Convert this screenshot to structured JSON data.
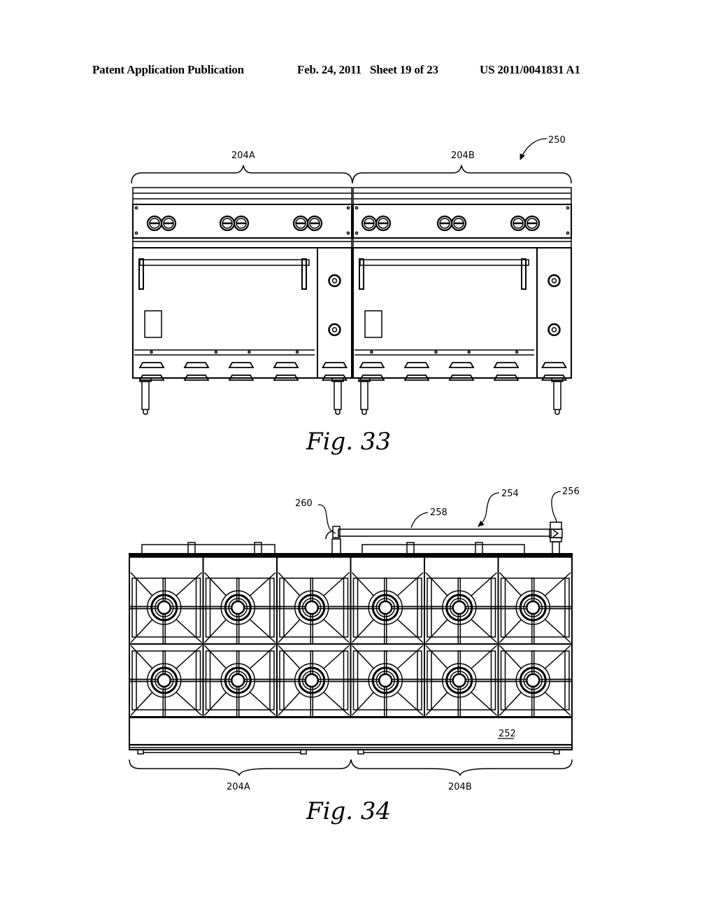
{
  "header": {
    "publication_type": "Patent Application Publication",
    "date": "Feb. 24, 2011",
    "sheet": "Sheet 19 of 23",
    "publication_number": "US 2011/0041831 A1"
  },
  "figures": [
    {
      "id": "fig33",
      "caption": "Fig. 33",
      "view": "front elevation",
      "labels": {
        "assembly": "250",
        "left_unit": "204A",
        "right_unit": "204B"
      },
      "units": [
        {
          "name": "204A",
          "knob_pairs": 3,
          "oven_door": true,
          "side_knobs": 2,
          "vent_slots": 8
        },
        {
          "name": "204B",
          "knob_pairs": 3,
          "oven_door": true,
          "side_knobs": 2,
          "vent_slots": 8
        }
      ]
    },
    {
      "id": "fig34",
      "caption": "Fig. 34",
      "view": "top plan",
      "labels": {
        "front_panel": "252",
        "gas_connector": "254",
        "valve": "256",
        "pipe": "258",
        "elbow": "260",
        "left_unit": "204A",
        "right_unit": "204B"
      },
      "burner_grid": {
        "rows": 2,
        "columns": 6
      }
    }
  ]
}
